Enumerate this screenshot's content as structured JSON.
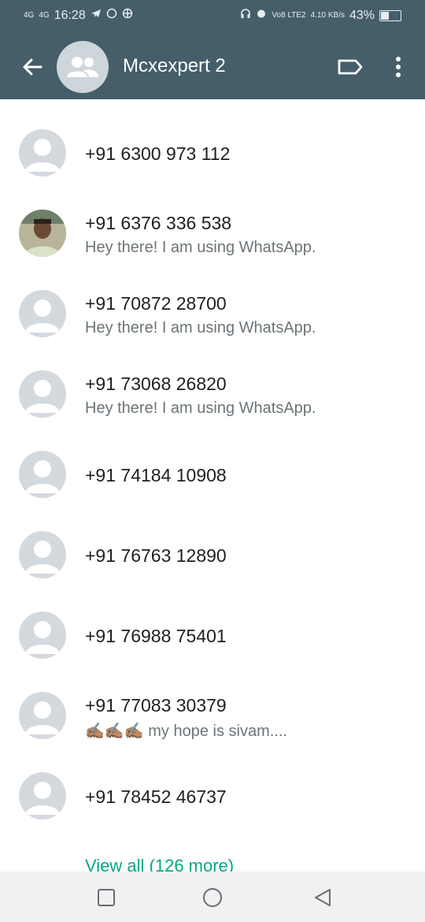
{
  "status_bar": {
    "net1": "4G",
    "net2": "4G",
    "time": "16:28",
    "volte": "Vo8 LTE2",
    "speed": "4.10 KB/s",
    "battery": "43%"
  },
  "header": {
    "title": "Mcxexpert 2"
  },
  "participants": [
    {
      "phone": "+91 6300 973 112",
      "about": ""
    },
    {
      "phone": "+91 6376 336 538",
      "about": "Hey there! I am using WhatsApp."
    },
    {
      "phone": "+91 70872 28700",
      "about": "Hey there! I am using WhatsApp."
    },
    {
      "phone": "+91 73068 26820",
      "about": "Hey there! I am using WhatsApp."
    },
    {
      "phone": "+91 74184 10908",
      "about": ""
    },
    {
      "phone": "+91 76763 12890",
      "about": ""
    },
    {
      "phone": "+91 76988 75401",
      "about": ""
    },
    {
      "phone": "+91 77083 30379",
      "about": "✍🏽✍🏽✍🏽 my hope is sivam...."
    },
    {
      "phone": "+91 78452 46737",
      "about": ""
    }
  ],
  "view_all": "View all (126 more)",
  "colors": {
    "header_bg": "#455e6a",
    "accent": "#00a884",
    "avatar_bg": "#d4d9de"
  }
}
